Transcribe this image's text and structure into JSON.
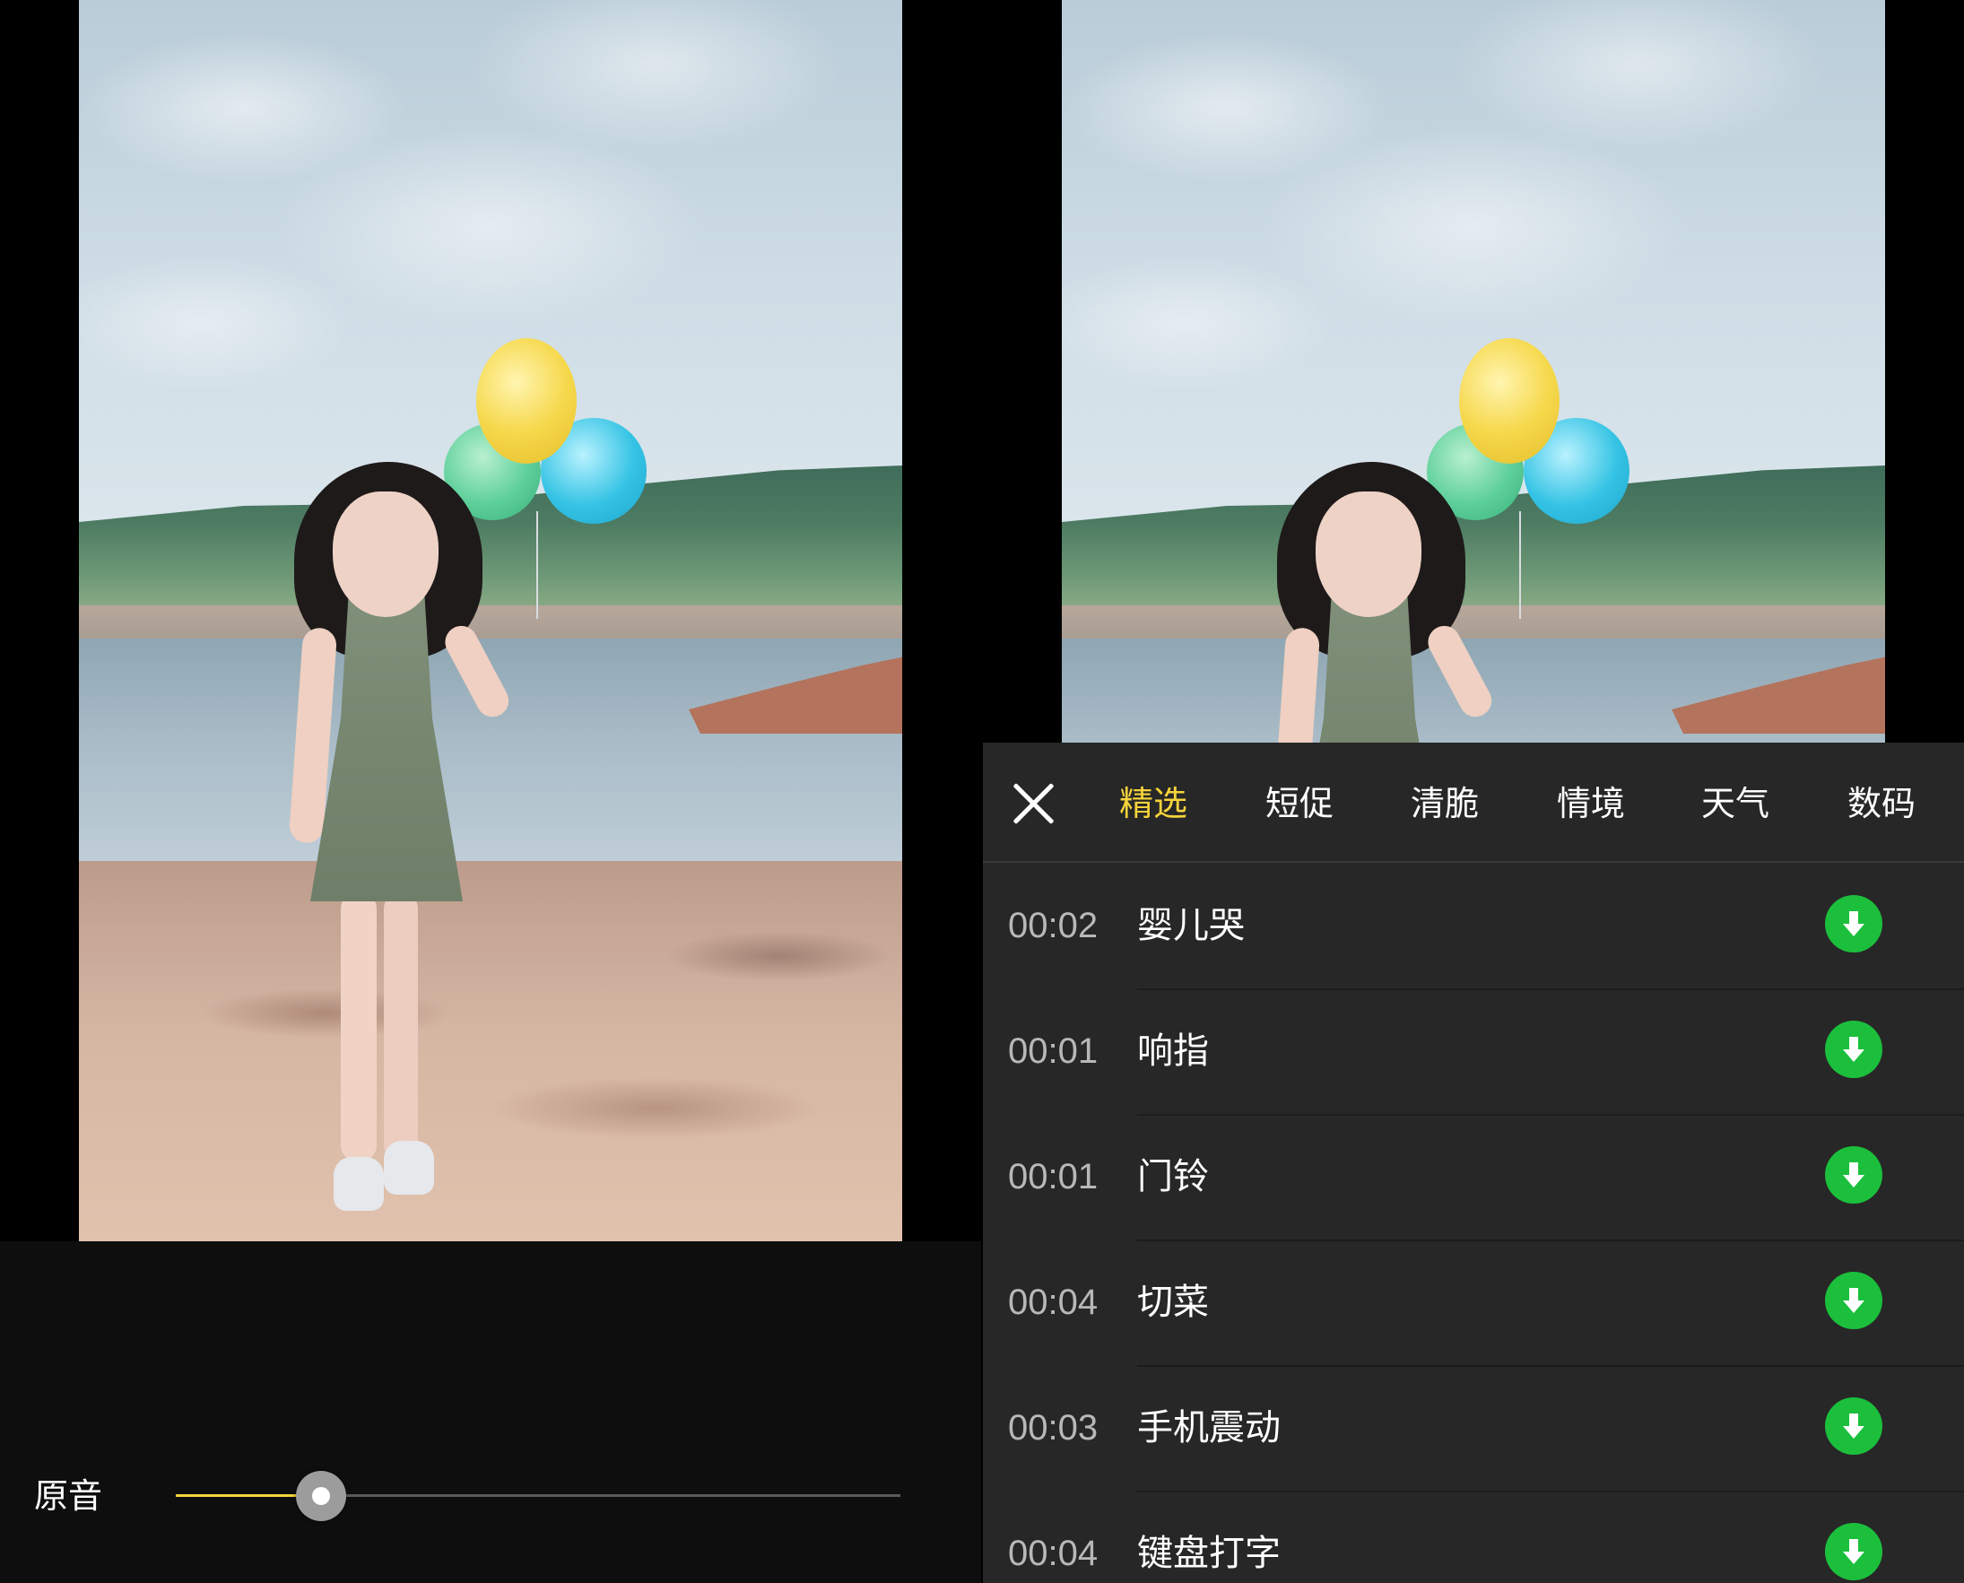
{
  "left": {
    "original_sound_label": "原音",
    "volume_level": 0.2
  },
  "sound_panel": {
    "tabs": [
      {
        "label": "精选",
        "active": true
      },
      {
        "label": "短促",
        "active": false
      },
      {
        "label": "清脆",
        "active": false
      },
      {
        "label": "情境",
        "active": false
      },
      {
        "label": "天气",
        "active": false
      },
      {
        "label": "数码",
        "active": false
      }
    ],
    "sounds": [
      {
        "duration": "00:02",
        "name": "婴儿哭"
      },
      {
        "duration": "00:01",
        "name": "响指"
      },
      {
        "duration": "00:01",
        "name": "门铃"
      },
      {
        "duration": "00:04",
        "name": "切菜"
      },
      {
        "duration": "00:03",
        "name": "手机震动"
      },
      {
        "duration": "00:04",
        "name": "键盘打字"
      }
    ]
  },
  "colors": {
    "accent": "#f5d33b",
    "download": "#1bbf3c",
    "panel": "#272727"
  },
  "icons": {
    "close": "close-icon",
    "download": "download-arrow-icon"
  }
}
